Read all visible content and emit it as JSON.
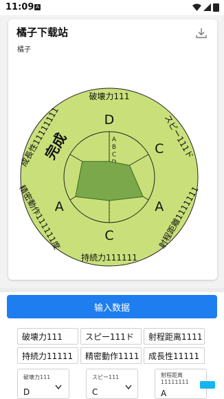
{
  "status_bar": {
    "time": "11:09",
    "app_badge": "A"
  },
  "card": {
    "title": "橘子下载站",
    "subtitle": "橘子"
  },
  "radar": {
    "stats": [
      {
        "name": "破壊力111",
        "grade": "D"
      },
      {
        "name": "スピー111ド",
        "grade": "C"
      },
      {
        "name": "射程距離1111111",
        "grade": "A"
      },
      {
        "name": "持続力111111",
        "grade": "C"
      },
      {
        "name": "精密動作111111度",
        "grade": "A"
      },
      {
        "name": "成長性11111111",
        "grade": "完成"
      }
    ],
    "scale_labels": [
      "A",
      "B",
      "C",
      "D",
      "E"
    ],
    "fill_color": "#c9e07a",
    "area_color": "#7aa84a"
  },
  "chart_data": {
    "type": "radar",
    "axes": [
      "破壊力111",
      "スピー111ド",
      "射程距離1111111",
      "持続力111111",
      "精密動作111111度",
      "成長性11111111"
    ],
    "scale": [
      "A",
      "B",
      "C",
      "D",
      "E"
    ],
    "values": [
      "D",
      "C",
      "A",
      "C",
      "A",
      "完成"
    ]
  },
  "actions": {
    "input_button": "输入数据"
  },
  "cells": [
    "破壊力111",
    "スピー111ド",
    "射程距离1111",
    "持続力11111",
    "精密動作1111",
    "成長性11111"
  ],
  "selects": [
    {
      "label": "破壊力111",
      "value": "D"
    },
    {
      "label": "スピー111",
      "value": "C"
    },
    {
      "label": "射程距离 11111111",
      "value": "A"
    }
  ]
}
